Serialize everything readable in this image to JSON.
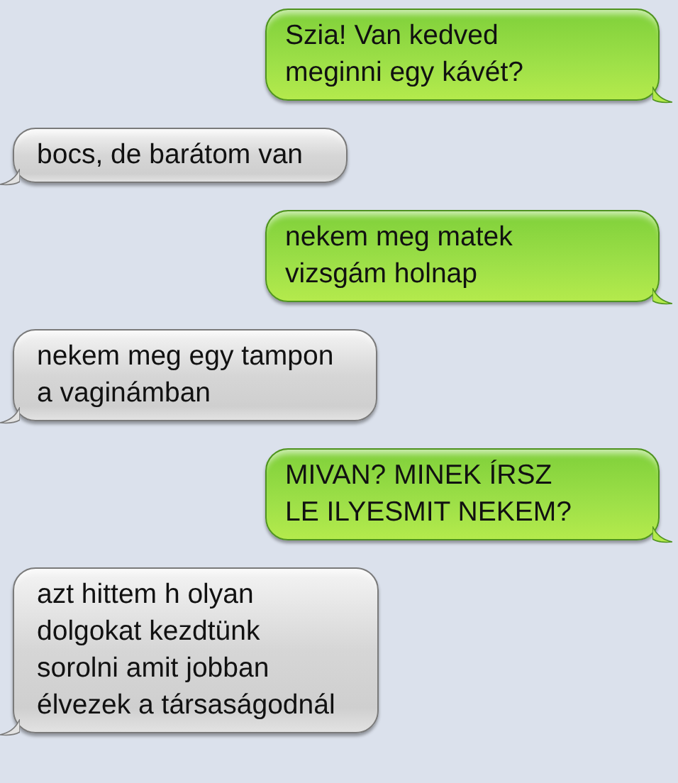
{
  "messages": [
    {
      "kind": "sent",
      "text": "Szia! Van kedved\nmeginni egy kávét?"
    },
    {
      "kind": "received",
      "text": "bocs, de barátom van"
    },
    {
      "kind": "sent",
      "text": "nekem meg matek\nvizsgám holnap"
    },
    {
      "kind": "received",
      "text": "nekem meg egy tampon\na vaginámban"
    },
    {
      "kind": "sent",
      "text": "MIVAN? MINEK ÍRSZ\nLE ILYESMIT NEKEM?"
    },
    {
      "kind": "received",
      "text": "azt hittem h olyan\ndolgokat kezdtünk\nsorolni amit jobban\nélvezek a társaságodnál"
    }
  ]
}
